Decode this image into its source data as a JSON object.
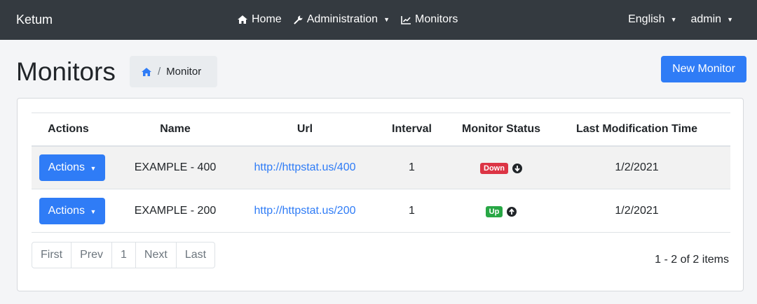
{
  "navbar": {
    "brand": "Ketum",
    "links": [
      {
        "label": "Home",
        "icon": "home-icon"
      },
      {
        "label": "Administration",
        "icon": "wrench-icon"
      },
      {
        "label": "Monitors",
        "icon": "line-chart-icon"
      }
    ],
    "language": "English",
    "user": "admin"
  },
  "page": {
    "title": "Monitors",
    "breadcrumb": "Monitor",
    "new_button": "New Monitor"
  },
  "table": {
    "headers": [
      "Actions",
      "Name",
      "Url",
      "Interval",
      "Monitor Status",
      "Last Modification Time"
    ],
    "rows": [
      {
        "action": "Actions",
        "name": "EXAMPLE - 400",
        "url": "http://httpstat.us/400",
        "interval": "1",
        "status": "Down",
        "time": "1/2/2021"
      },
      {
        "action": "Actions",
        "name": "EXAMPLE - 200",
        "url": "http://httpstat.us/200",
        "interval": "1",
        "status": "Up",
        "time": "1/2/2021"
      }
    ]
  },
  "pagination": {
    "first": "First",
    "prev": "Prev",
    "current": "1",
    "next": "Next",
    "last": "Last",
    "summary": "1 - 2 of 2 items"
  },
  "colors": {
    "navbar": "#343a40",
    "primary": "#2f7cf6",
    "down": "#dc3545",
    "up": "#28a745"
  }
}
